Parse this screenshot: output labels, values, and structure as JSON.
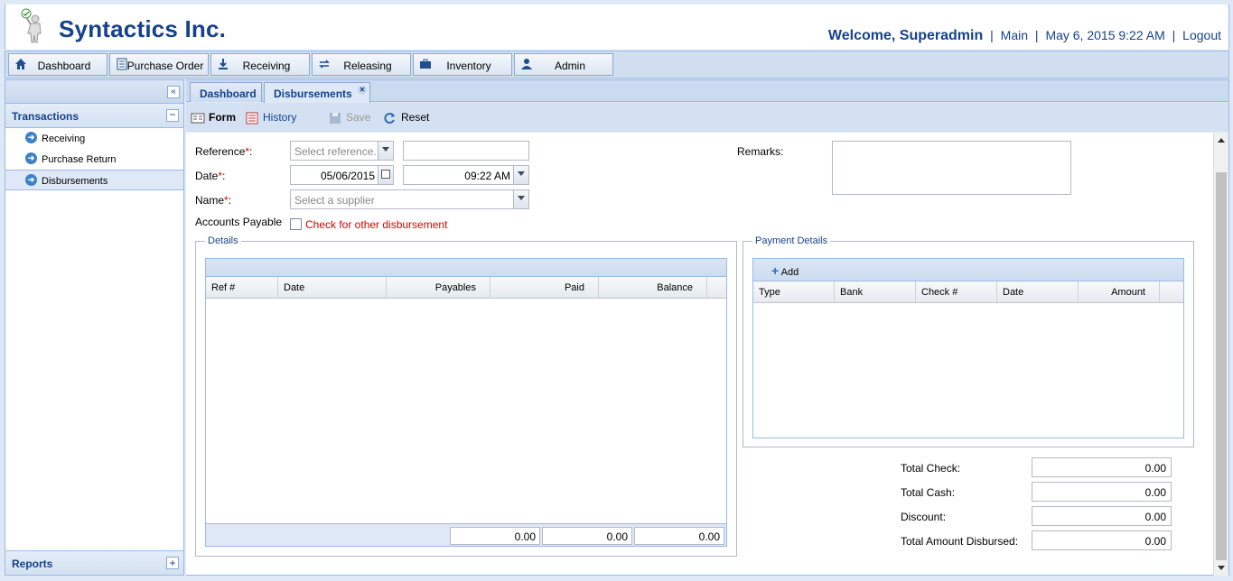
{
  "header": {
    "company": "Syntactics Inc.",
    "welcome": "Welcome, Superadmin",
    "main_link": "Main",
    "datetime": "May 6, 2015 9:22 AM",
    "logout_link": "Logout"
  },
  "topnav": [
    {
      "label": "Dashboard",
      "icon": "home-icon"
    },
    {
      "label": "Purchase Order",
      "icon": "document-icon"
    },
    {
      "label": "Receiving",
      "icon": "download-icon"
    },
    {
      "label": "Releasing",
      "icon": "refresh-icon"
    },
    {
      "label": "Inventory",
      "icon": "briefcase-icon"
    },
    {
      "label": "Admin",
      "icon": "user-icon"
    }
  ],
  "sidebar": {
    "collapse_glyph": "«",
    "section_title": "Transactions",
    "items": [
      {
        "label": "Receiving"
      },
      {
        "label": "Purchase Return"
      },
      {
        "label": "Disbursements"
      }
    ],
    "reports_title": "Reports"
  },
  "tabs": [
    {
      "label": "Dashboard"
    },
    {
      "label": "Disbursements"
    }
  ],
  "toolbar": {
    "form": "Form",
    "history": "History",
    "save": "Save",
    "reset": "Reset"
  },
  "form": {
    "reference_label": "Reference",
    "reference_placeholder": "Select reference.",
    "date_label": "Date",
    "date_value": "05/06/2015",
    "time_value": "09:22 AM",
    "name_label": "Name",
    "name_placeholder": "Select a supplier",
    "accounts_payable_label": "Accounts Payable",
    "other_disbursement_label": "Check for other disbursement",
    "remarks_label": "Remarks:",
    "colon": ":",
    "asterisk": "*"
  },
  "details": {
    "legend": "Details",
    "columns": [
      "Ref #",
      "Date",
      "Payables",
      "Paid",
      "Balance"
    ],
    "totals": [
      "0.00",
      "0.00",
      "0.00"
    ]
  },
  "payment": {
    "legend": "Payment Details",
    "add_label": "Add",
    "columns": [
      "Type",
      "Bank",
      "Check #",
      "Date",
      "Amount"
    ]
  },
  "totals": {
    "total_check_label": "Total Check:",
    "total_check": "0.00",
    "total_cash_label": "Total Cash:",
    "total_cash": "0.00",
    "discount_label": "Discount:",
    "discount": "0.00",
    "total_disbursed_label": "Total Amount Disbursed:",
    "total_disbursed": "0.00"
  }
}
